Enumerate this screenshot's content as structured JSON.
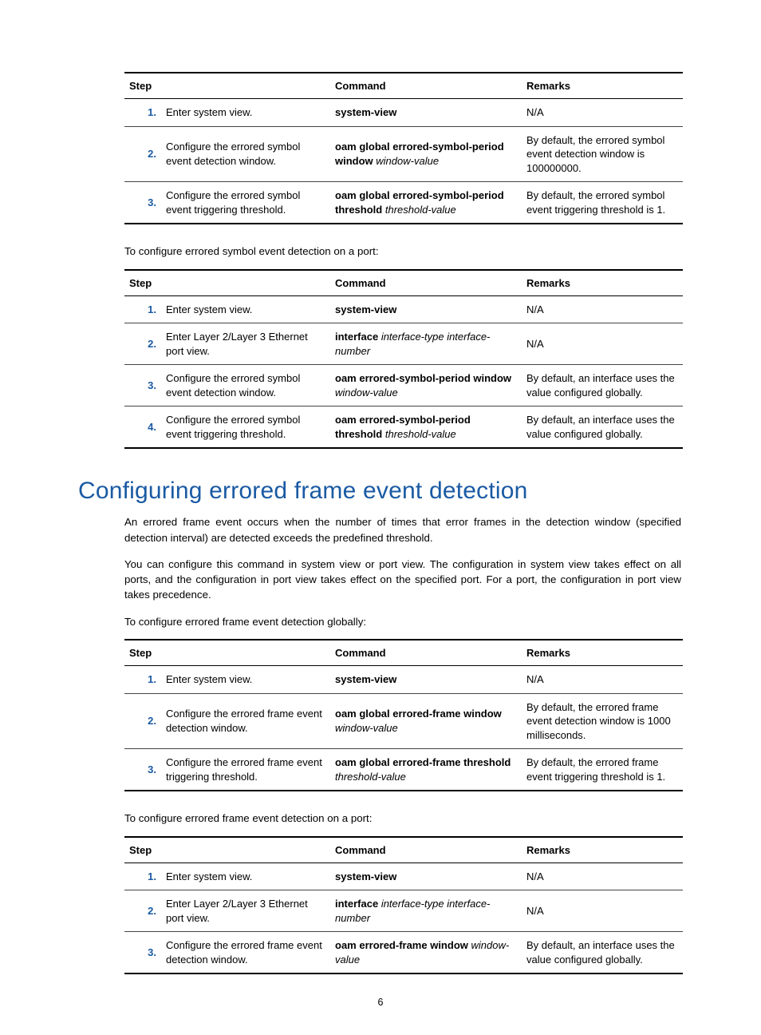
{
  "tableHeaders": {
    "step": "Step",
    "command": "Command",
    "remarks": "Remarks"
  },
  "table1": {
    "rows": [
      {
        "n": "1.",
        "step": "Enter system view.",
        "cmdBold": "system-view",
        "cmdItal": "",
        "rmk": "N/A"
      },
      {
        "n": "2.",
        "step": "Configure the errored symbol event detection window.",
        "cmdBold": "oam global errored-symbol-period window",
        "cmdItal": " window-value",
        "rmk": "By default, the errored symbol event detection window is 100000000."
      },
      {
        "n": "3.",
        "step": "Configure the errored symbol event triggering threshold.",
        "cmdBold": "oam global errored-symbol-period threshold",
        "cmdItal": " threshold-value",
        "rmk": "By default, the errored symbol event triggering threshold is 1."
      }
    ]
  },
  "para1": "To configure errored symbol event detection on a port:",
  "table2": {
    "rows": [
      {
        "n": "1.",
        "step": "Enter system view.",
        "cmdBold": "system-view",
        "cmdItal": "",
        "rmk": "N/A"
      },
      {
        "n": "2.",
        "step": "Enter Layer 2/Layer 3 Ethernet port view.",
        "cmdBold": "interface",
        "cmdItal": " interface-type interface-number",
        "rmk": "N/A"
      },
      {
        "n": "3.",
        "step": "Configure the errored symbol event detection window.",
        "cmdBold": "oam errored-symbol-period window",
        "cmdItal": " window-value",
        "rmk": "By default, an interface uses the value configured globally."
      },
      {
        "n": "4.",
        "step": "Configure the errored symbol event triggering threshold.",
        "cmdBold": "oam errored-symbol-period threshold",
        "cmdItal": " threshold-value",
        "rmk": "By default, an interface uses the value configured globally."
      }
    ]
  },
  "heading": "Configuring errored frame event detection",
  "para2": "An errored frame event occurs when the number of times that error frames in the detection window (specified detection interval) are detected exceeds the predefined threshold.",
  "para3": "You can configure this command in system view or port view. The configuration in system view takes effect on all ports, and the configuration in port view takes effect on the specified port. For a port, the configuration in port view takes precedence.",
  "para4": "To configure errored frame event detection globally:",
  "table3": {
    "rows": [
      {
        "n": "1.",
        "step": "Enter system view.",
        "cmdBold": "system-view",
        "cmdItal": "",
        "rmk": "N/A"
      },
      {
        "n": "2.",
        "step": "Configure the errored frame event detection window.",
        "cmdBold": "oam global errored-frame window",
        "cmdItal": " window-value",
        "rmk": "By default, the errored frame event detection window is 1000 milliseconds."
      },
      {
        "n": "3.",
        "step": "Configure the errored frame event triggering threshold.",
        "cmdBold": "oam global errored-frame threshold",
        "cmdItal": " threshold-value",
        "rmk": "By default, the errored frame event triggering threshold is 1."
      }
    ]
  },
  "para5": "To configure errored frame event detection on a port:",
  "table4": {
    "rows": [
      {
        "n": "1.",
        "step": "Enter system view.",
        "cmdBold": "system-view",
        "cmdItal": "",
        "rmk": "N/A"
      },
      {
        "n": "2.",
        "step": "Enter Layer 2/Layer 3 Ethernet port view.",
        "cmdBold": "interface",
        "cmdItal": " interface-type interface-number",
        "rmk": "N/A"
      },
      {
        "n": "3.",
        "step": "Configure the errored frame event detection window.",
        "cmdBold": "oam errored-frame window",
        "cmdItal": " window-value",
        "rmk": "By default, an interface uses the value configured globally."
      }
    ]
  },
  "pageNumber": "6"
}
